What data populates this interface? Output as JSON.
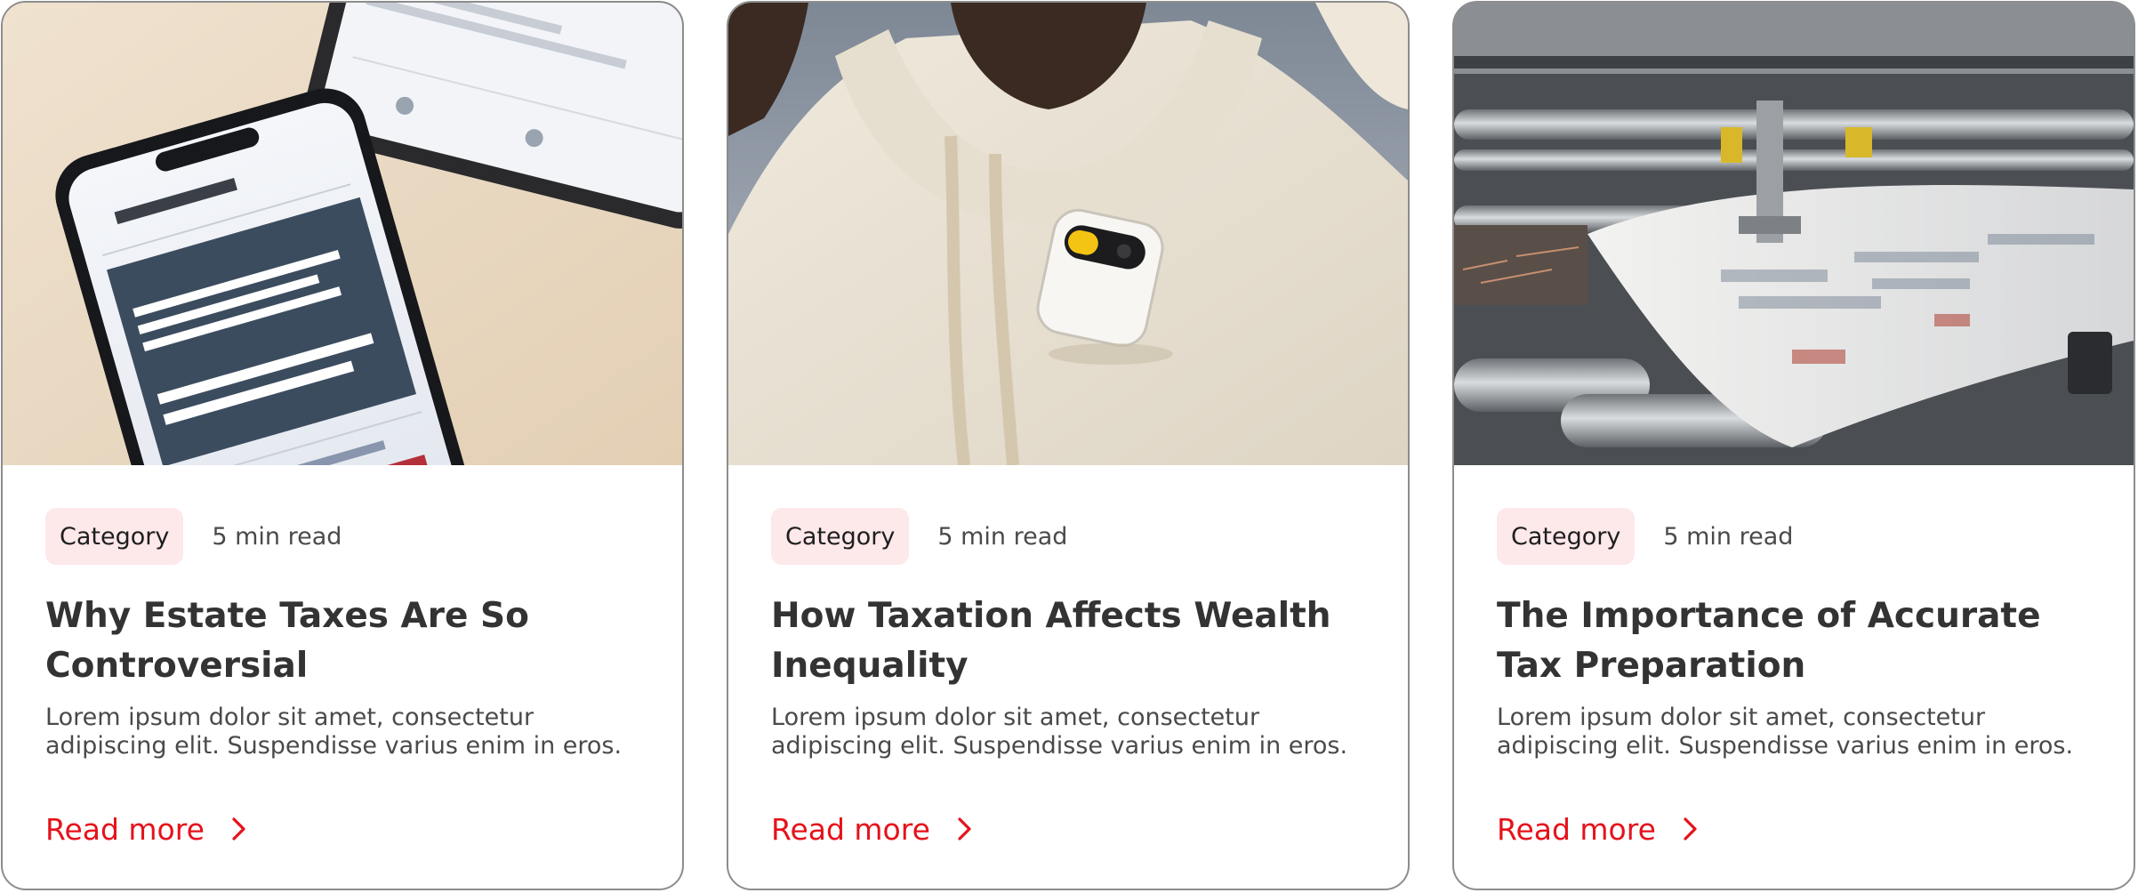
{
  "colors": {
    "accent": "#e5121b",
    "badge_bg": "#fde8ea",
    "title": "#333333",
    "body": "#4a4a4a",
    "border": "#8d8d8d"
  },
  "cards": [
    {
      "image_alt": "Phone and tablet showing a news app with headlines",
      "category": "Category",
      "read_time": "5 min read",
      "title": "Why Estate Taxes Are So Controversial",
      "excerpt": "Lorem ipsum dolor sit amet, consectetur adipiscing elit. Suspendisse varius enim in eros.",
      "link_label": "Read more",
      "link_icon": "chevron-right-icon"
    },
    {
      "image_alt": "Person in a cream hoodie wearing a small white clip-on device",
      "category": "Category",
      "read_time": "5 min read",
      "title": "How Taxation Affects Wealth Inequality",
      "excerpt": "Lorem ipsum dolor sit amet, consectetur adipiscing elit. Suspendisse varius enim in eros.",
      "link_label": "Read more",
      "link_icon": "chevron-right-icon"
    },
    {
      "image_alt": "Newspaper printing press with pages running through rollers",
      "category": "Category",
      "read_time": "5 min read",
      "title": "The Importance of Accurate Tax Preparation",
      "excerpt": "Lorem ipsum dolor sit amet, consectetur adipiscing elit. Suspendisse varius enim in eros.",
      "link_label": "Read more",
      "link_icon": "chevron-right-icon"
    }
  ]
}
